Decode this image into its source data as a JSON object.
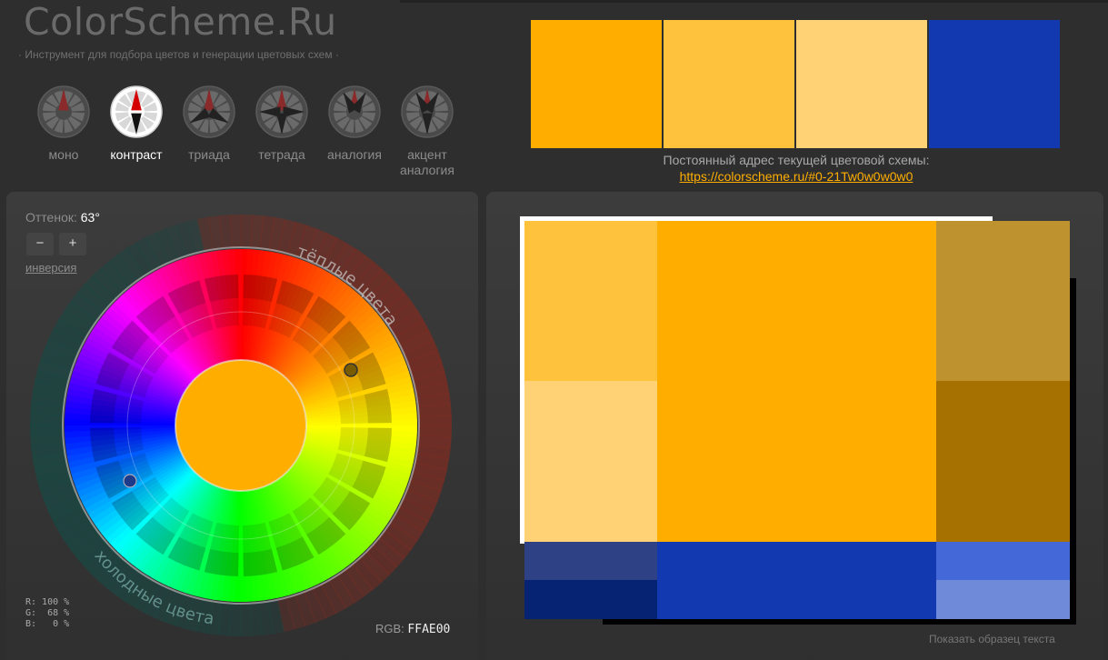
{
  "header": {
    "logo": "ColorScheme.Ru",
    "tagline": "· Инструмент для подбора цветов и генерации цветовых схем ·"
  },
  "modes": [
    {
      "label": "моно",
      "active": false
    },
    {
      "label": "контраст",
      "active": true
    },
    {
      "label": "триада",
      "active": false
    },
    {
      "label": "тетрада",
      "active": false
    },
    {
      "label": "аналогия",
      "active": false
    },
    {
      "label": "акцент аналогия",
      "active": false
    }
  ],
  "swatches": [
    "#FFAE00",
    "#FFC23D",
    "#FFD275",
    "#1239B0"
  ],
  "permalink": {
    "label": "Постоянный адрес текущей цветовой схемы:",
    "url": "https://colorscheme.ru/#0-21Tw0w0w0w0"
  },
  "controls": {
    "hue_label": "Оттенок:",
    "hue_value": "63°",
    "minus": "−",
    "plus": "+",
    "inversion": "инверсия"
  },
  "wheel": {
    "warm_label": "тёплые цвета",
    "cold_label": "холодные цвета",
    "center_color": "#FFAE00"
  },
  "readout": {
    "r": "R: 100 %",
    "g": "G:  68 %",
    "b": "B:   0 %",
    "rgb_label": "RGB:",
    "rgb_value": "FFAE00"
  },
  "preview_colors": {
    "primary": "#FFAE00",
    "primary_light": "#FFC23D",
    "primary_lighter": "#FFD275",
    "primary_muted": "#BF9230",
    "primary_dark": "#A67100",
    "complement": "#1239B0",
    "complement_muted": "#2D4184",
    "complement_dark": "#062373",
    "complement_light": "#4468D8",
    "complement_lighter": "#6F8AD8"
  },
  "show_text": "Показать образец текста"
}
